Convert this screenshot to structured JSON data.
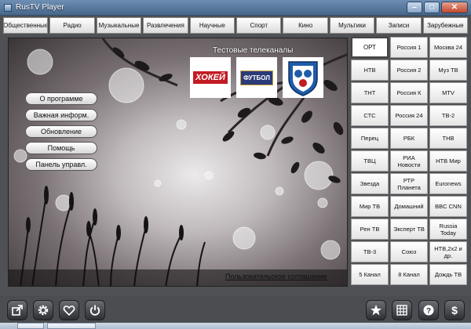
{
  "window": {
    "title": "RusTV Player"
  },
  "tabs": [
    "Общественные",
    "Радио",
    "Музыкальные",
    "Развлечения",
    "Научные",
    "Спорт",
    "Кино",
    "Мультики",
    "Записи",
    "Зарубежные"
  ],
  "main": {
    "testing_title": "Тестовые телеканалы",
    "tiles": [
      {
        "label": "ХОКЕЙ"
      },
      {
        "label": "ФУТБОЛ"
      },
      {
        "label": "КХЛ"
      }
    ],
    "menu": [
      "О программе",
      "Важная информ.",
      "Обновление",
      "Помощь",
      "Панель управл."
    ],
    "agreement": "Пользовательское соглашение"
  },
  "channels": [
    "ОРТ",
    "Россия 1",
    "Москва 24",
    "НТВ",
    "Россия 2",
    "Муз ТВ",
    "ТНТ",
    "Россия К",
    "MTV",
    "СТС",
    "Россия 24",
    "ТВ-2",
    "Перец",
    "РБК",
    "ТНВ",
    "ТВЦ",
    "РИА Новости",
    "НТВ Мир",
    "Звезда",
    "РТР Планета",
    "Euronews",
    "Мир ТВ",
    "Домашний",
    "BBC CNN",
    "Рен ТВ",
    "Эксперт ТВ",
    "Russia Today",
    "ТВ-3",
    "Союз",
    "НТВ,2x2 и др.",
    "5 Канал",
    "8 Канал",
    "Дождь ТВ"
  ],
  "selected_channel": "ОРТ",
  "colors": {
    "titlebar": "#5a7aa0",
    "toolbar": "#4b4d51",
    "accent_red": "#c21b24"
  },
  "toolbar_left": [
    {
      "icon": "external-link-icon"
    },
    {
      "icon": "gear-icon"
    },
    {
      "icon": "heart-icon"
    },
    {
      "icon": "power-icon"
    }
  ],
  "toolbar_right": [
    {
      "icon": "star-icon"
    },
    {
      "icon": "grid-icon"
    },
    {
      "icon": "help-icon"
    },
    {
      "icon": "dollar-icon"
    }
  ]
}
